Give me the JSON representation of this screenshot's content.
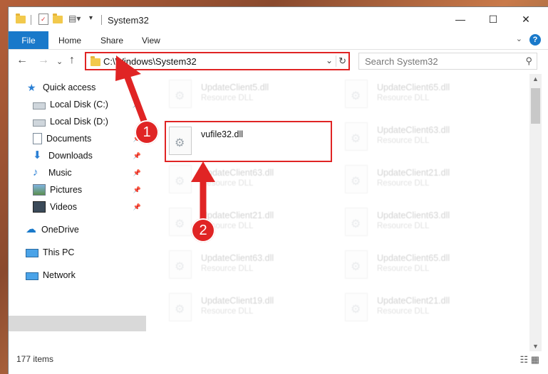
{
  "window": {
    "title": "System32",
    "controls": {
      "minimize": "—",
      "maximize": "☐",
      "close": "✕"
    }
  },
  "ribbon": {
    "tabs": [
      "File",
      "Home",
      "Share",
      "View"
    ],
    "help": "?"
  },
  "address": {
    "path": "C:\\Windows\\System32",
    "search_placeholder": "Search System32"
  },
  "nav": {
    "items": [
      {
        "label": "Quick access",
        "icon": "star-icon"
      },
      {
        "label": "Local Disk (C:)",
        "icon": "drive-icon"
      },
      {
        "label": "Local Disk (D:)",
        "icon": "drive-icon"
      },
      {
        "label": "Documents",
        "icon": "documents-icon"
      },
      {
        "label": "Downloads",
        "icon": "download-icon"
      },
      {
        "label": "Music",
        "icon": "music-icon"
      },
      {
        "label": "Pictures",
        "icon": "pictures-icon"
      },
      {
        "label": "Videos",
        "icon": "videos-icon"
      },
      {
        "label": "OneDrive",
        "icon": "cloud-icon"
      },
      {
        "label": "This PC",
        "icon": "computer-icon"
      },
      {
        "label": "Network",
        "icon": "network-icon"
      }
    ]
  },
  "files": {
    "highlighted": {
      "name": "vufile32.dll"
    },
    "left_column": [
      {
        "name": "UpdateClient5.dll",
        "type": "Resource DLL"
      },
      {
        "name": "UpdateClient63.dll",
        "type": "Resource DLL"
      },
      {
        "name": "UpdateClient21.dll",
        "type": "Resource DLL"
      },
      {
        "name": "UpdateClient63.dll",
        "type": "Resource DLL"
      },
      {
        "name": "UpdateClient19.dll",
        "type": "Resource DLL"
      }
    ],
    "right_column": [
      {
        "name": "UpdateClient65.dll",
        "type": "Resource DLL"
      },
      {
        "name": "UpdateClient63.dll",
        "type": "Resource DLL"
      },
      {
        "name": "UpdateClient21.dll",
        "type": "Resource DLL"
      },
      {
        "name": "UpdateClient63.dll",
        "type": "Resource DLL"
      },
      {
        "name": "UpdateClient65.dll",
        "type": "Resource DLL"
      },
      {
        "name": "UpdateClient21.dll",
        "type": "Resource DLL"
      }
    ]
  },
  "status": {
    "items_count": "177 items"
  },
  "annotations": {
    "step1": "1",
    "step2": "2",
    "color": "#e02424"
  }
}
